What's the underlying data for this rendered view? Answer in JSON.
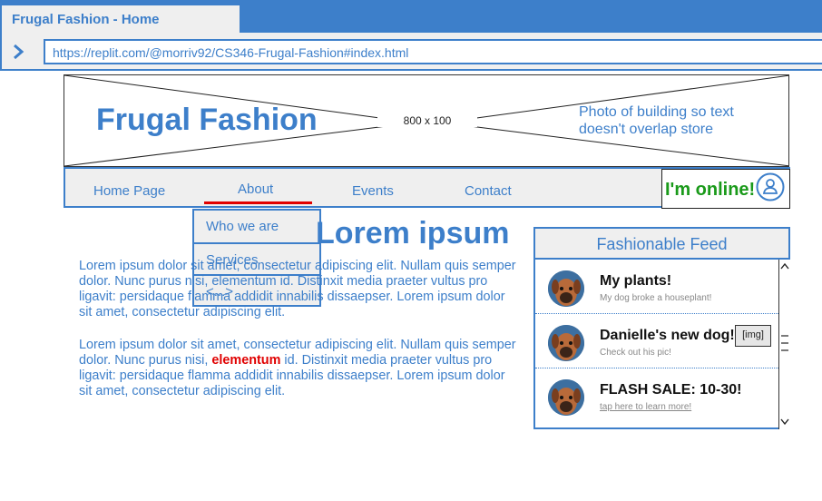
{
  "browser": {
    "tab_title": "Frugal Fashion - Home",
    "url": "https://replit.com/@morriv92/CS346-Frugal-Fashion#index.html"
  },
  "banner": {
    "title": "Frugal Fashion",
    "dimensions": "800 x 100",
    "note": "Photo of building so text doesn't overlap store"
  },
  "nav": {
    "items": [
      "Home Page",
      "About",
      "Events",
      "Contact"
    ],
    "active": "About",
    "online_label": "I'm online!"
  },
  "dropdown": {
    "items": [
      "Who we are",
      "Services",
      "<...>"
    ]
  },
  "main": {
    "heading": "Lorem ipsum",
    "paragraph1": "Lorem ipsum dolor sit amet, consectetur adipiscing elit. Nullam quis semper dolor. Nunc purus nisi, elementum id. Distinxit media praeter vultus pro ligavit: persidaque flamma addidit innabilis dissaepser. Lorem ipsum dolor sit amet, consectetur adipiscing elit.",
    "paragraph2_before": "Lorem ipsum dolor sit amet, consectetur adipiscing elit. Nullam quis semper dolor. Nunc purus nisi, ",
    "paragraph2_highlight": "elementum",
    "paragraph2_after": " id. Distinxit  media praeter vultus pro ligavit: persidaque flamma addidit innabilis dissaepser. Lorem ipsum dolor sit amet, consectetur adipiscing elit."
  },
  "feed": {
    "title": "Fashionable Feed",
    "posts": [
      {
        "title": "My plants!",
        "subtitle": "My dog broke a houseplant!"
      },
      {
        "title": "Danielle's new dog!",
        "subtitle": "Check out his pic!",
        "image_label": "[img]"
      },
      {
        "title": "FLASH SALE: 10-30!",
        "subtitle": "tap here to learn more!"
      }
    ]
  },
  "colors": {
    "accent": "#3d7fca",
    "online": "#1a9a1a",
    "highlight": "#e00000",
    "panel": "#efefef"
  }
}
